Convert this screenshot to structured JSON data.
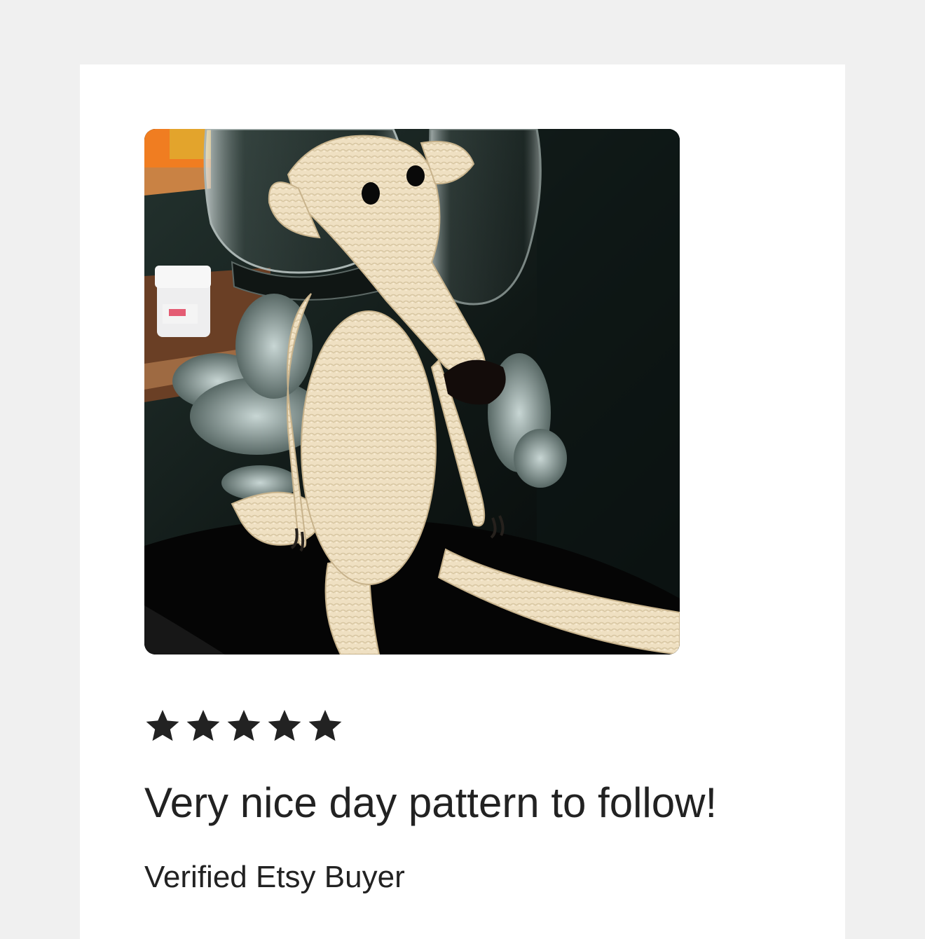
{
  "review": {
    "rating": 5,
    "rating_max": 5,
    "title": "Very nice day pattern to follow!",
    "author": "Verified Etsy Buyer",
    "star_color": "#222222",
    "photo_icon": "crochet-dog-photo"
  }
}
